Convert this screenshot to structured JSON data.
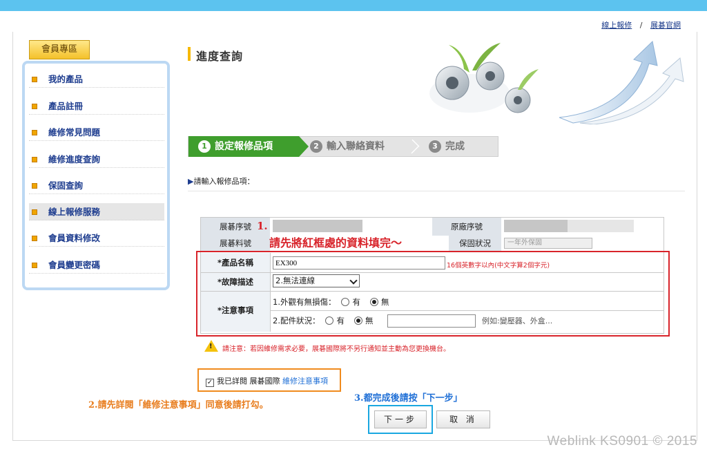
{
  "top_links": {
    "online_repair": "線上報修",
    "separator": "/",
    "official_site": "展碁官網"
  },
  "sidebar": {
    "title": "會員專區",
    "items": [
      {
        "label": "我的產品"
      },
      {
        "label": "產品註冊"
      },
      {
        "label": "維修常見問題"
      },
      {
        "label": "維修進度查詢"
      },
      {
        "label": "保固查詢"
      },
      {
        "label": "線上報修服務"
      },
      {
        "label": "會員資料修改"
      },
      {
        "label": "會員變更密碼"
      }
    ]
  },
  "page_title": "進度查詢",
  "steps": [
    {
      "num": "1",
      "label": "設定報修品項"
    },
    {
      "num": "2",
      "label": "輸入聯絡資料"
    },
    {
      "num": "3",
      "label": "完成"
    }
  ],
  "section_label": "請輸入報修品項：",
  "section_marker": "▶",
  "form": {
    "serial_label": "展碁序號",
    "original_serial_label": "原廠序號",
    "part_no_label": "展碁料號",
    "warranty_label": "保固狀況",
    "warranty_value": "一年外保固",
    "product_name_label": "*產品名稱",
    "product_name_value": "EX300",
    "product_name_hint": "16個英數字以內(中文字算2個字元)",
    "fault_label": "*故障描述",
    "fault_value": "2.無法連線",
    "notes_label": "*注意事項",
    "notes_q1": "1.外觀有無損傷：",
    "notes_q2": "2.配件狀況：",
    "opt_yes": "有",
    "opt_no": "無",
    "accessory_example": "例如:變壓器、外盒..."
  },
  "notice": "請注意：若因維修需求必要，展碁國際將不另行通知並主動為您更換機台。",
  "agree": {
    "check_mark": "✓",
    "text": "我已詳閱 展碁國際",
    "link": "維修注意事項"
  },
  "buttons": {
    "next": "下一步",
    "cancel": "取 消"
  },
  "annotations": {
    "a1_num": "1.",
    "a1_text": "請先將紅框處的資料填完～",
    "a2": "2.請先詳閱「維修注意事項」同意後請打勾。",
    "a3": "3.都完成後請按「下一步」"
  },
  "watermark": "Weblink KS0901 © 2015",
  "colors": {
    "top_bar": "#5cc3ef",
    "step_active": "#3f9e2d",
    "annotation_red": "#d8232a",
    "annotation_orange": "#e87d1e",
    "annotation_blue": "#1f6fd6"
  }
}
